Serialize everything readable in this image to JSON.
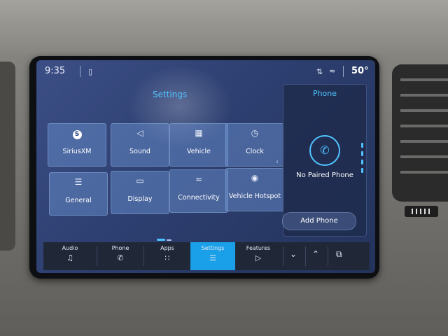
{
  "status_bar": {
    "time": "9:35",
    "temperature": "50°",
    "icons": [
      "phone-status-icon",
      "signal-icon",
      "wifi-icon"
    ]
  },
  "settings": {
    "title": "Settings",
    "tiles": [
      {
        "label": "SiriusXM",
        "icon": "siriusxm-icon"
      },
      {
        "label": "Sound",
        "icon": "speaker-icon"
      },
      {
        "label": "Vehicle",
        "icon": "vehicle-icon"
      },
      {
        "label": "Clock",
        "icon": "clock-icon"
      },
      {
        "label": "General",
        "icon": "sliders-icon"
      },
      {
        "label": "Display",
        "icon": "display-icon"
      },
      {
        "label": "Connectivity",
        "icon": "wifi-icon"
      },
      {
        "label": "Vehicle Hotspot",
        "icon": "hotspot-icon"
      }
    ]
  },
  "phone_panel": {
    "title": "Phone",
    "status": "No Paired Phone",
    "add_button": "Add Phone"
  },
  "nav": {
    "items": [
      {
        "label": "Audio",
        "icon": "music-note-icon"
      },
      {
        "label": "Phone",
        "icon": "phone-icon"
      },
      {
        "label": "Apps",
        "icon": "apps-grid-icon"
      },
      {
        "label": "Settings",
        "icon": "sliders-icon",
        "active": true
      },
      {
        "label": "Features",
        "icon": "vehicle-features-icon"
      }
    ],
    "controls": [
      "chevron-down-icon",
      "chevron-up-icon",
      "copy-screens-icon"
    ]
  },
  "colors": {
    "accent": "#4fc3ff",
    "active_tab": "#1aa0e8",
    "screen_bg": "#2d3f70"
  }
}
